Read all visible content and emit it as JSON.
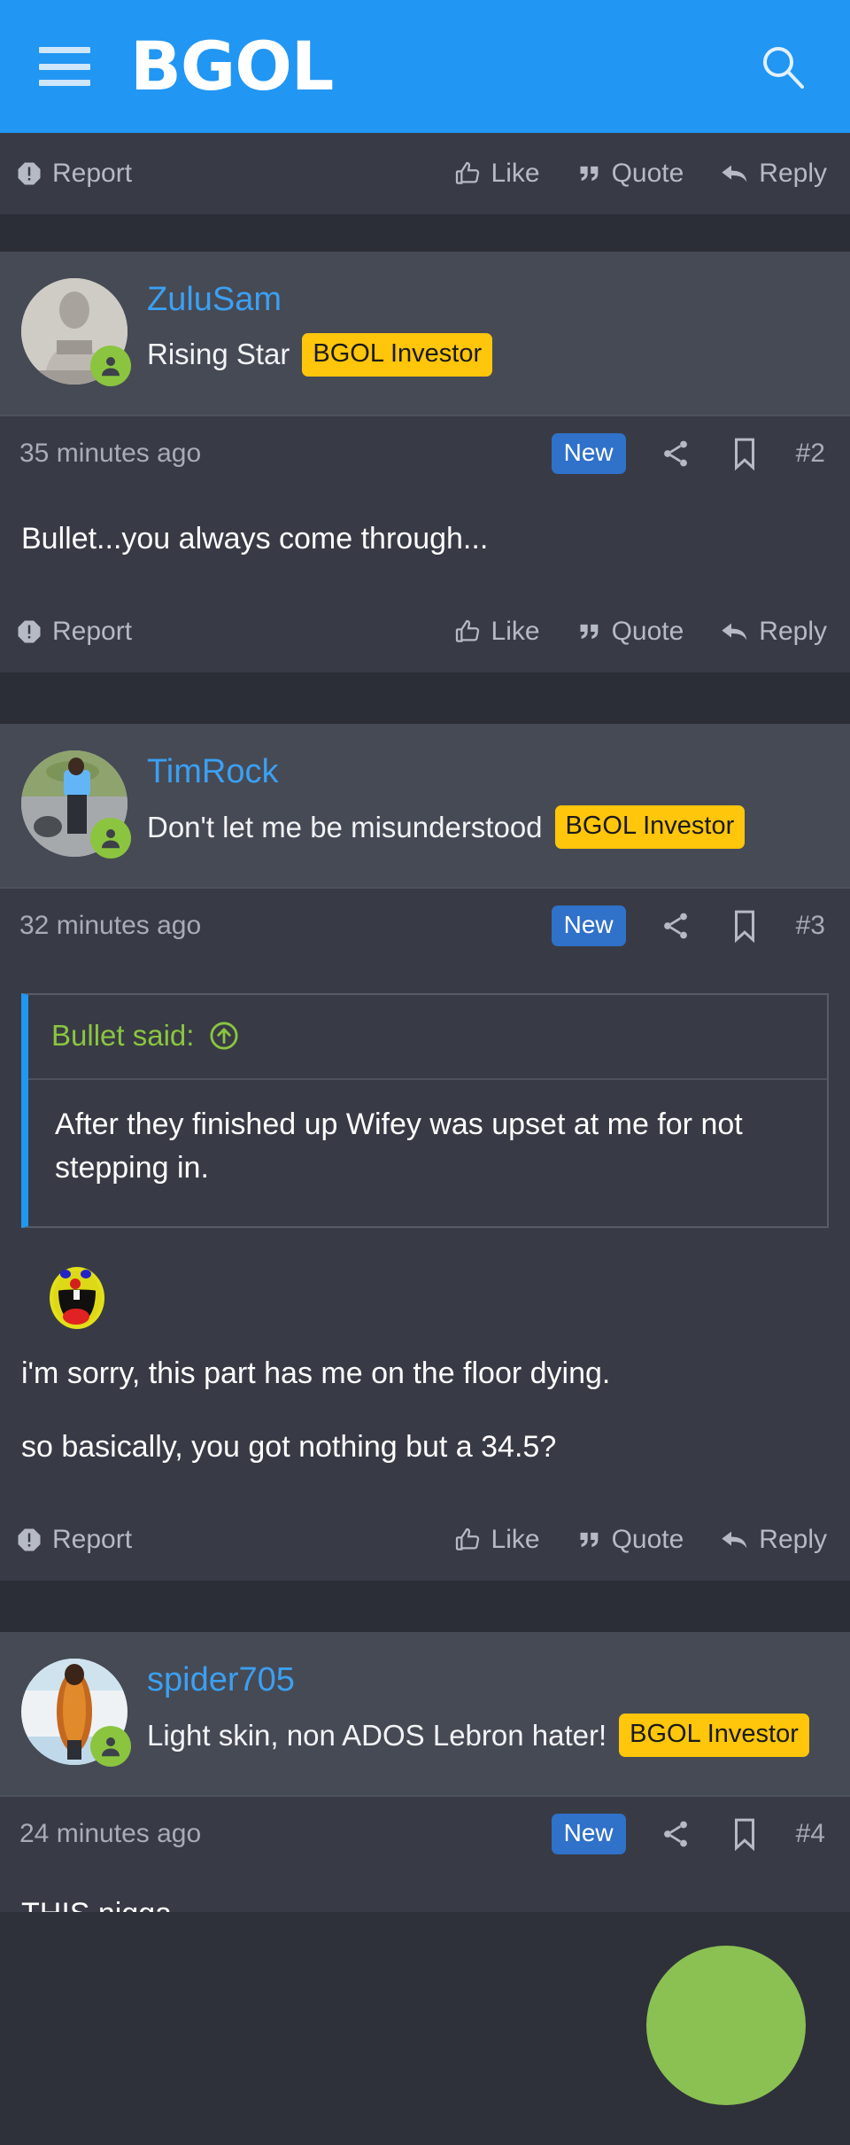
{
  "appbar": {
    "menu_icon": "hamburger-menu-icon",
    "brand": "BGOL",
    "search_icon": "search-icon",
    "background_color": "#2196f3"
  },
  "action_labels": {
    "report": "Report",
    "like": "Like",
    "quote": "Quote",
    "reply": "Reply"
  },
  "colors": {
    "accent_blue": "#2196f3",
    "badge_yellow": "#ffc60b",
    "badge_new_blue": "#3071ca",
    "link_blue": "#3ba0f2",
    "quote_green": "#8bc53f",
    "status_green": "#8bc53f",
    "tap_overlay_green": "#8bc153",
    "post_header_bg": "#464a55",
    "post_body_bg": "#383b45",
    "page_bg": "#2b2e36"
  },
  "top_action_row": {
    "report": "Report",
    "like": "Like",
    "quote": "Quote",
    "reply": "Reply"
  },
  "posts": [
    {
      "username": "ZuluSam",
      "user_title": "Rising Star",
      "badge": "BGOL Investor",
      "avatar_alt": "statue-avatar",
      "timestamp": "35 minutes ago",
      "new_badge": "New",
      "post_number": "#2",
      "body_paragraphs": [
        "Bullet...you always come through..."
      ],
      "quote": null
    },
    {
      "username": "TimRock",
      "user_title": "Don't let me be misunderstood",
      "badge": "BGOL Investor",
      "avatar_alt": "street-photo-avatar",
      "timestamp": "32 minutes ago",
      "new_badge": "New",
      "post_number": "#3",
      "quote": {
        "author_line": "Bullet said:",
        "jump_icon": "circle-up-arrow-icon",
        "text": "After they finished up Wifey was upset at me for not stepping in."
      },
      "emoji": "laughing-mouth-open-smiley",
      "body_paragraphs": [
        "i'm sorry, this part has me on the floor dying.",
        "so basically, you got nothing but a 34.5?"
      ]
    },
    {
      "username": "spider705",
      "user_title": "Light skin, non ADOS Lebron hater!",
      "badge": "BGOL Investor",
      "avatar_alt": "person-photo-avatar",
      "timestamp": "24 minutes ago",
      "new_badge": "New",
      "post_number": "#4",
      "body_paragraphs": [
        "THIS nigga"
      ],
      "quote": null
    }
  ],
  "overlay": {
    "name": "tap-indicator",
    "color": "#8bc153"
  }
}
